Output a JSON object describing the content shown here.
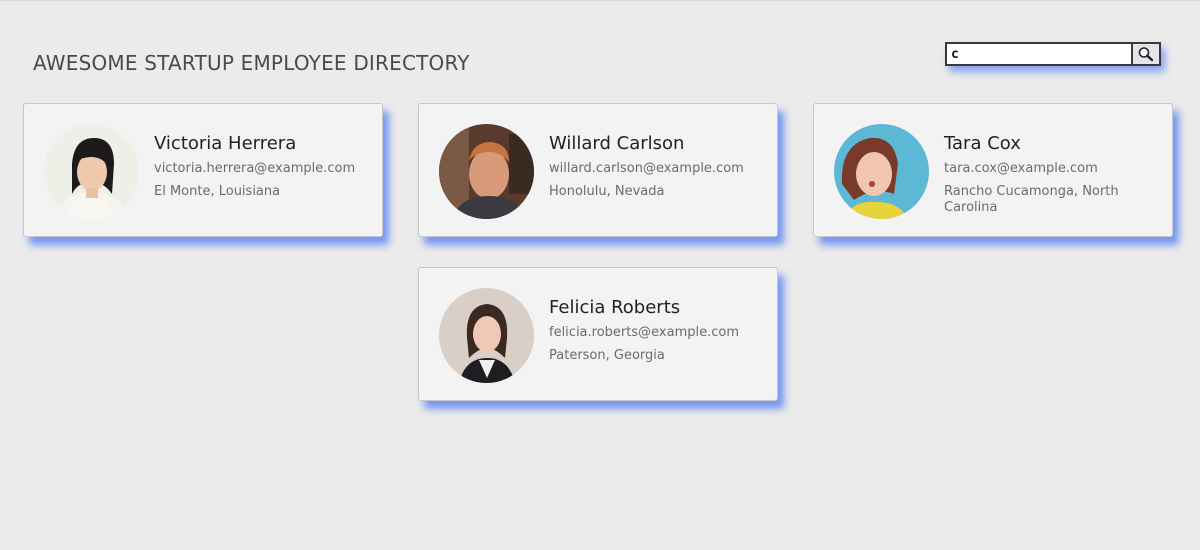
{
  "header": {
    "title": "AWESOME STARTUP EMPLOYEE DIRECTORY"
  },
  "search": {
    "value": "c",
    "button_icon": "magnifier-icon"
  },
  "employees": [
    {
      "name": "Victoria Herrera",
      "email": "victoria.herrera@example.com",
      "location": "El Monte, Louisiana",
      "avatar_bg": "#eef0e8"
    },
    {
      "name": "Willard Carlson",
      "email": "willard.carlson@example.com",
      "location": "Honolulu, Nevada",
      "avatar_bg": "#5a3a2c"
    },
    {
      "name": "Tara Cox",
      "email": "tara.cox@example.com",
      "location": "Rancho Cucamonga, North Carolina",
      "avatar_bg": "#5db8d6"
    },
    {
      "name": "Felicia Roberts",
      "email": "felicia.roberts@example.com",
      "location": "Paterson, Georgia",
      "avatar_bg": "#d9cfc6"
    }
  ],
  "colors": {
    "page_bg": "#ebebeb",
    "card_bg": "#f3f3f3",
    "card_shadow": "#5f87f5"
  }
}
